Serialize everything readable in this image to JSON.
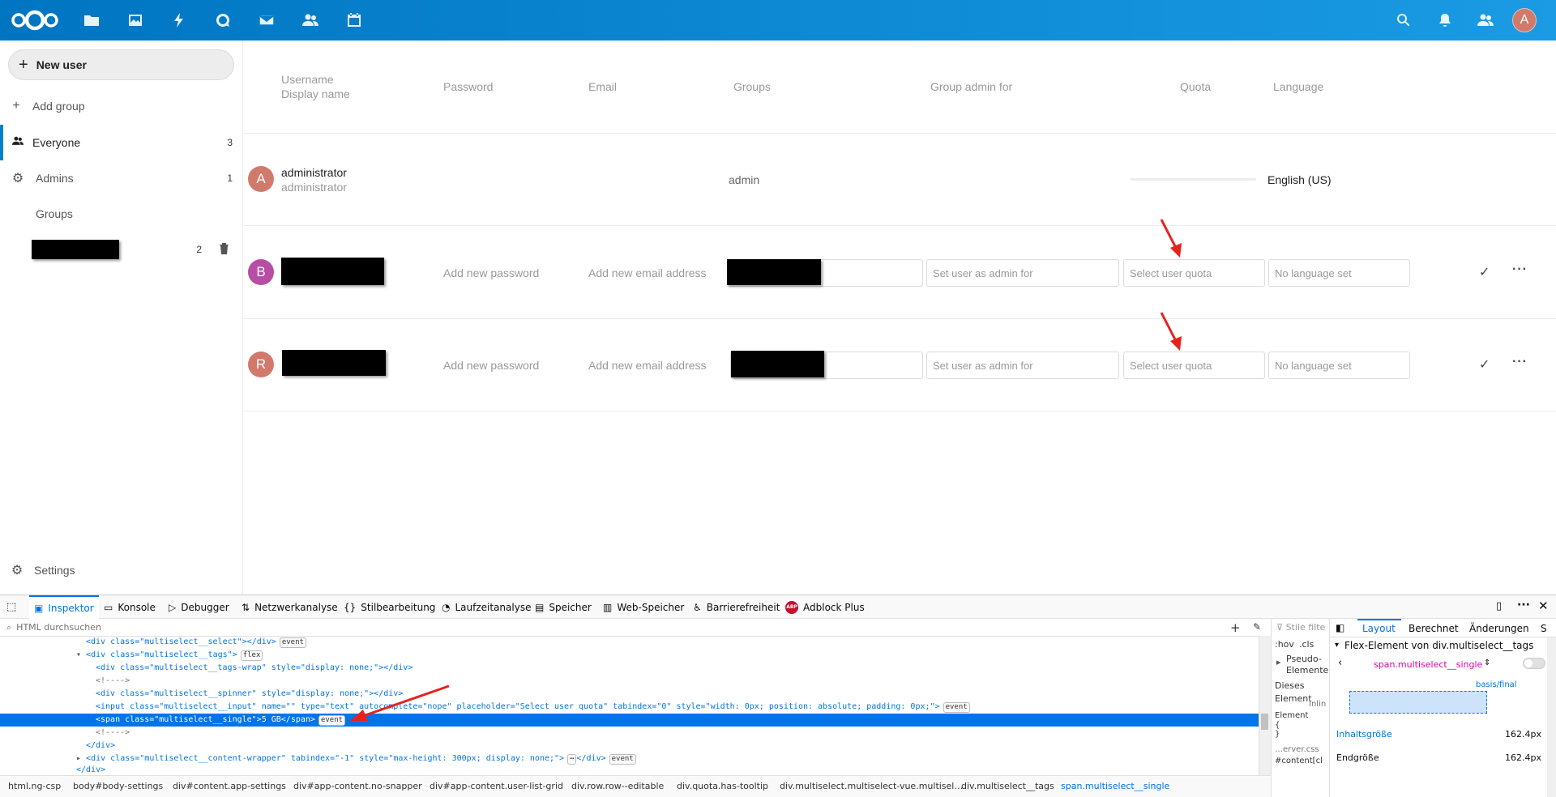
{
  "header": {
    "avatar_letter": "A",
    "nav_icons": [
      "files-icon",
      "photos-icon",
      "activity-icon",
      "talk-icon",
      "mail-icon",
      "contacts-icon",
      "calendar-icon"
    ],
    "right_icons": [
      "search-icon",
      "notifications-icon",
      "contacts-menu-icon"
    ]
  },
  "sidebar": {
    "new_user": "New user",
    "add_group": "Add group",
    "everyone": {
      "label": "Everyone",
      "count": "3"
    },
    "admins": {
      "label": "Admins",
      "count": "1"
    },
    "groups_heading": "Groups",
    "redacted_group_count": "2",
    "settings": "Settings"
  },
  "table": {
    "headers": {
      "username": "Username",
      "display_name": "Display name",
      "password": "Password",
      "email": "Email",
      "groups": "Groups",
      "group_admin": "Group admin for",
      "quota": "Quota",
      "language": "Language"
    },
    "admin_row": {
      "avatar": "A",
      "username": "administrator",
      "display_name": "administrator",
      "group": "admin",
      "language": "English (US)"
    },
    "edit_rows": [
      {
        "avatar": "B",
        "password_placeholder": "Add new password",
        "email_placeholder": "Add new email address",
        "group_admin_placeholder": "Set user as admin for",
        "quota_placeholder": "Select user quota",
        "language_placeholder": "No language set"
      },
      {
        "avatar": "R",
        "password_placeholder": "Add new password",
        "email_placeholder": "Add new email address",
        "group_admin_placeholder": "Set user as admin for",
        "quota_placeholder": "Select user quota",
        "language_placeholder": "No language set"
      }
    ]
  },
  "colors": {
    "header_blue": "#0082c9",
    "avatar_a": "#d17a6b",
    "avatar_b": "#b64ea4",
    "avatar_r": "#d17a6b",
    "devtools_accent": "#0074e8",
    "annotation_red": "#e8211d"
  },
  "devtools": {
    "tabs": [
      "Inspektor",
      "Konsole",
      "Debugger",
      "Netzwerkanalyse",
      "Stilbearbeitung",
      "Laufzeitanalyse",
      "Speicher",
      "Web-Speicher",
      "Barrierefreiheit",
      "Adblock Plus"
    ],
    "search_placeholder": "HTML durchsuchen",
    "code_lines": [
      "<div class=\"multiselect__select\"></div>",
      "<div class=\"multiselect__tags\">",
      "<div class=\"multiselect__tags-wrap\" style=\"display: none;\"></div>",
      "<!---->",
      "<div class=\"multiselect__spinner\" style=\"display: none;\"></div>",
      "<input class=\"multiselect__input\" name=\"\" type=\"text\" autocomplete=\"nope\" placeholder=\"Select user quota\" tabindex=\"0\" style=\"width: 0px; position: absolute; padding: 0px;\">",
      "<span class=\"multiselect__single\">5 GB</span>",
      "<!---->",
      "</div>",
      "<div class=\"multiselect__content-wrapper\" tabindex=\"-1\" style=\"max-height: 300px; display: none;\">",
      "</div>"
    ],
    "badges": {
      "event": "event",
      "flex": "flex",
      "ellipsis": "⋯"
    },
    "breadcrumbs": [
      "html.ng-csp",
      "body#body-settings",
      "div#content.app-settings",
      "div#app-content.no-snapper",
      "div#app-content.user-list-grid",
      "div.row.row--editable",
      "div.quota.has-tooltip",
      "div.multiselect.multiselect-vue.multisel…",
      "div.multiselect__tags",
      "span.multiselect__single"
    ],
    "rules": {
      "filter": "Stile filte",
      "hov": ":hov",
      "cls": ".cls",
      "pseudo": "Pseudo-Elemente",
      "this_element": "Dieses Element",
      "element": "Element",
      "inline": "Inlin",
      "open": "{",
      "close": "}",
      "file": "…erver.css",
      "selector": "#content[cl"
    },
    "layout": {
      "tabs": [
        "Layout",
        "Berechnet",
        "Änderungen",
        "S"
      ],
      "flex_title": "Flex-Element von div.multiselect__tags",
      "selected": "span.multiselect__single",
      "basis": "basis/final",
      "content_size_label": "Inhaltsgröße",
      "content_size_value": "162.4px",
      "final_size_label": "Endgröße",
      "final_size_value": "162.4px"
    }
  }
}
